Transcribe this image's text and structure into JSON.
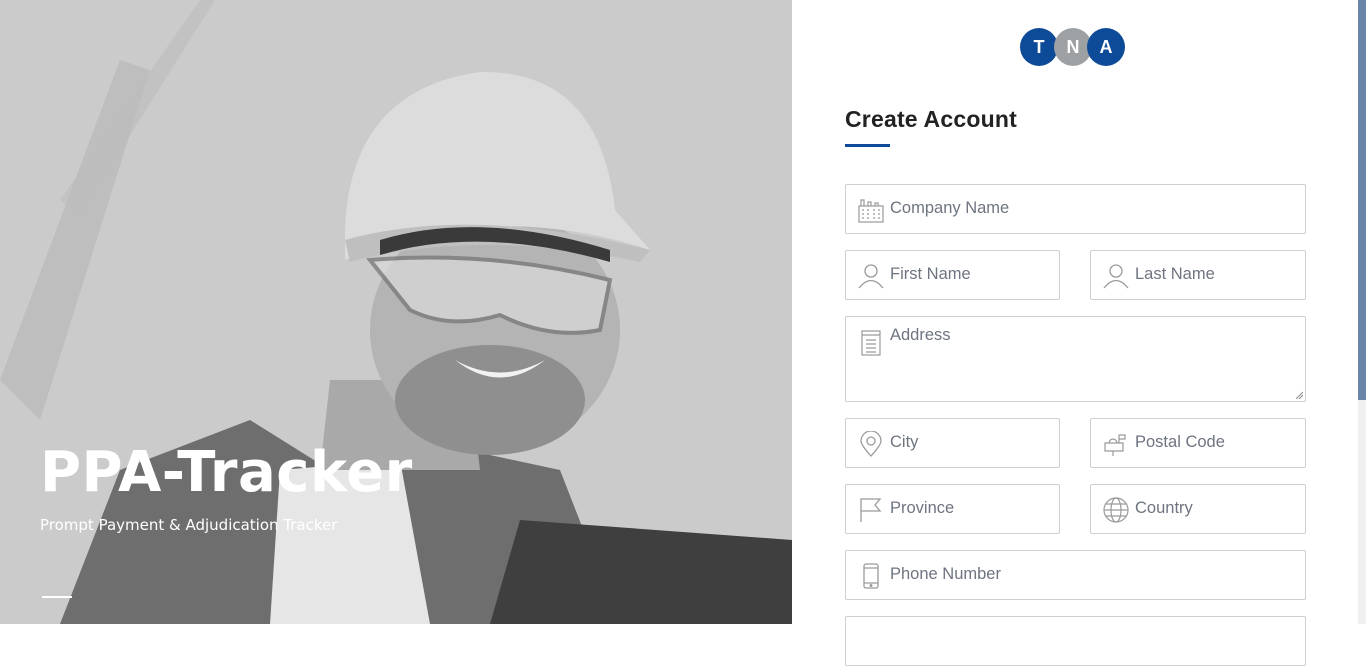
{
  "hero": {
    "title": "PPA-Tracker",
    "subtitle": "Prompt Payment & Adjudication Tracker"
  },
  "logo": {
    "letters": [
      "T",
      "N",
      "A"
    ],
    "colors": [
      "#0d4a97",
      "#9ea1a4",
      "#0d4a97"
    ]
  },
  "form": {
    "title": "Create Account",
    "accent_color": "#0d4a97",
    "fields": {
      "company": {
        "placeholder": "Company Name",
        "icon": "building-icon"
      },
      "first_name": {
        "placeholder": "First Name",
        "icon": "user-icon"
      },
      "last_name": {
        "placeholder": "Last Name",
        "icon": "user-icon"
      },
      "address": {
        "placeholder": "Address",
        "icon": "document-icon"
      },
      "city": {
        "placeholder": "City",
        "icon": "map-pin-icon"
      },
      "postal_code": {
        "placeholder": "Postal Code",
        "icon": "mailbox-icon"
      },
      "province": {
        "placeholder": "Province",
        "icon": "flag-icon"
      },
      "country": {
        "placeholder": "Country",
        "icon": "globe-icon"
      },
      "phone": {
        "placeholder": "Phone Number",
        "icon": "phone-icon"
      }
    }
  }
}
